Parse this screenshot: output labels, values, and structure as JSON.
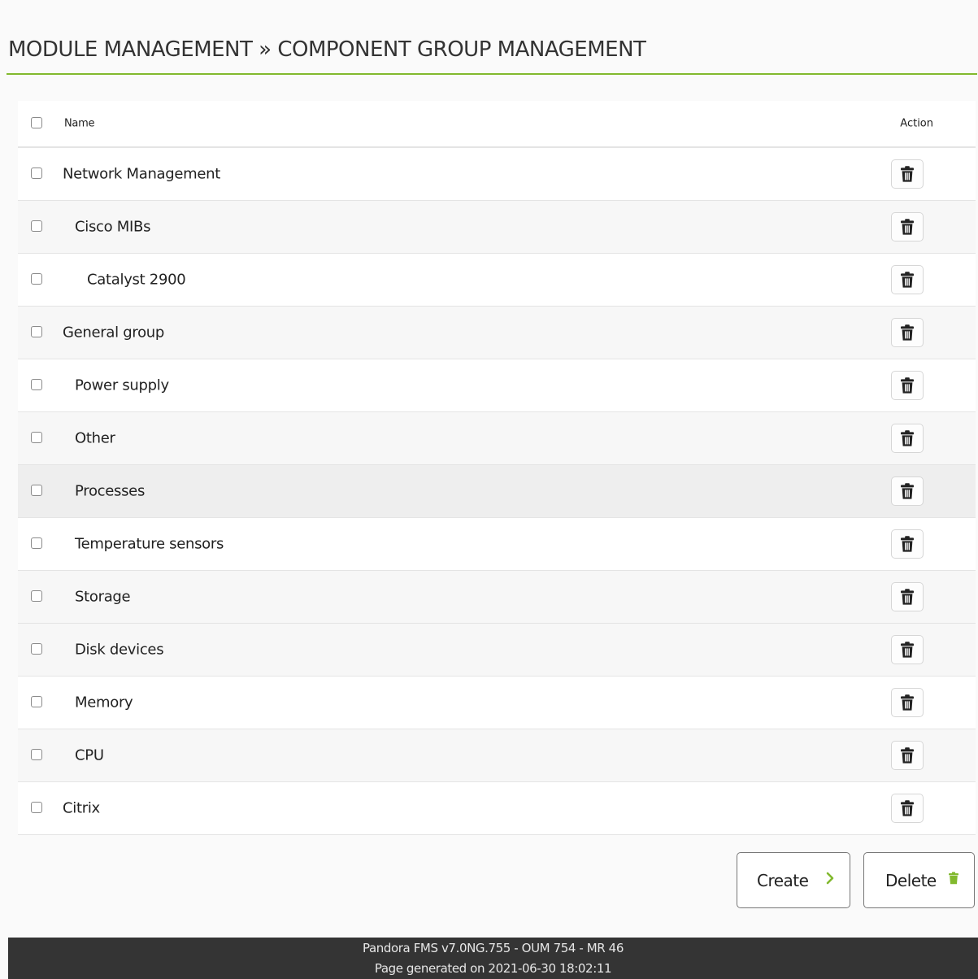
{
  "header": {
    "title": "MODULE MANAGEMENT » COMPONENT GROUP MANAGEMENT"
  },
  "table": {
    "columns": {
      "name": "Name",
      "action": "Action"
    },
    "rows": [
      {
        "name": "Network Management",
        "level": 0
      },
      {
        "name": "Cisco MIBs",
        "level": 1
      },
      {
        "name": "Catalyst 2900",
        "level": 2
      },
      {
        "name": "General group",
        "level": 0
      },
      {
        "name": "Power supply",
        "level": 1
      },
      {
        "name": "Other",
        "level": 1
      },
      {
        "name": "Processes",
        "level": 1
      },
      {
        "name": "Temperature sensors",
        "level": 1
      },
      {
        "name": "Storage",
        "level": 1
      },
      {
        "name": "Disk devices",
        "level": 1
      },
      {
        "name": "Memory",
        "level": 1
      },
      {
        "name": "CPU",
        "level": 1
      },
      {
        "name": "Citrix",
        "level": 0
      }
    ],
    "row_action_icon": "trash-icon"
  },
  "buttons": {
    "create": {
      "label": "Create",
      "icon": "chevron-right-icon"
    },
    "delete": {
      "label": "Delete",
      "icon": "trash-icon"
    }
  },
  "footer": {
    "version": "Pandora FMS v7.0NG.755 - OUM 754 - MR 46",
    "generated": "Page generated on 2021-06-30 18:02:11"
  },
  "colors": {
    "accent": "#82b92e",
    "footer_bg": "#343434"
  }
}
